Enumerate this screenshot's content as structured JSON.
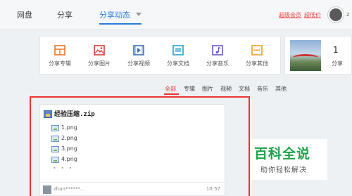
{
  "nav": {
    "items": [
      "网盘",
      "分享",
      "分享动态"
    ],
    "vip_links": [
      "超级会员",
      "超低价"
    ],
    "user_initial": "z"
  },
  "share_bar": [
    {
      "label": "分享专辑",
      "icon": "album-icon",
      "color": "#e8742b"
    },
    {
      "label": "分享图片",
      "icon": "picture-icon",
      "color": "#d33c3c"
    },
    {
      "label": "分享视频",
      "icon": "video-icon",
      "color": "#3b6fb6"
    },
    {
      "label": "分享文档",
      "icon": "document-icon",
      "color": "#2aa0c9"
    },
    {
      "label": "分享音乐",
      "icon": "music-icon",
      "color": "#6a55c8"
    },
    {
      "label": "分享其他",
      "icon": "other-icon",
      "color": "#f0a020"
    }
  ],
  "profile": {
    "count": "1",
    "label": "分享"
  },
  "filters": [
    "全部",
    "专辑",
    "图片",
    "视频",
    "文档",
    "音乐",
    "其他"
  ],
  "card": {
    "title": "经验压缩.zip",
    "files": [
      "1.png",
      "2.png",
      "3.png",
      "4.png"
    ],
    "more": "• • •",
    "user": "zhan******...",
    "time": "10:57"
  },
  "watermark": {
    "title": "百科全说",
    "subtitle": "助你轻松解决"
  },
  "colors": {
    "accent": "#2b7bd6",
    "highlight": "#e33333",
    "watermark": "#1fa34a"
  }
}
